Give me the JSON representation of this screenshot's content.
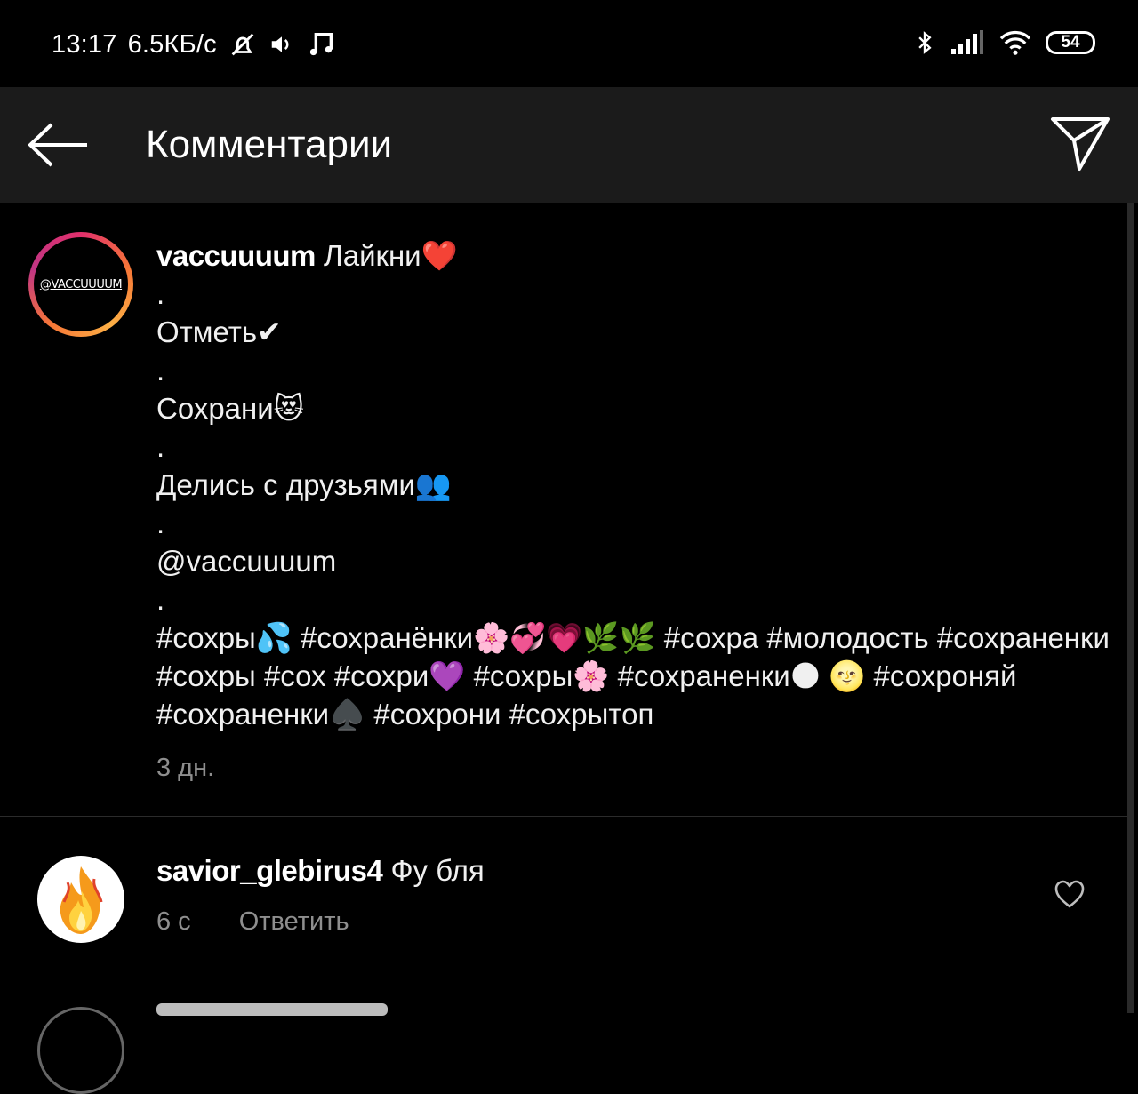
{
  "status_bar": {
    "time": "13:17",
    "speed": "6.5КБ/с",
    "battery": "54",
    "icons": [
      "alarm-off-icon",
      "volume-icon",
      "music-note-icon",
      "bluetooth-icon",
      "signal-icon",
      "wifi-icon",
      "battery-icon"
    ]
  },
  "header": {
    "title": "Комментарии",
    "back_icon": "arrow-left-icon",
    "send_icon": "send-icon"
  },
  "caption": {
    "avatar_text": "@VACCUUUUM",
    "username": "vaccuuuum",
    "lines": [
      " Лайкни❤️",
      ".",
      "Отметь✔",
      ".",
      "Сохрани😻",
      ".",
      "Делись с друзьями👥",
      ".",
      "@vaccuuuum",
      "."
    ],
    "hashtags": "#сохры💦 #сохранёнки🌸💞💗🌿🌿 #сохра #молодость #сохраненки #сохры #сох #сохри💜 #сохры🌸 #сохраненки🌑 🌝 #сохроняй #сохраненки♠️ #сохрони #сохрытоп",
    "age": "3 дн."
  },
  "comments": [
    {
      "username": "savior_glebirus4",
      "text": " Фу бля",
      "age": "6 с",
      "reply_label": "Ответить",
      "avatar_icon": "fire-icon",
      "like_icon": "heart-outline-icon"
    }
  ]
}
